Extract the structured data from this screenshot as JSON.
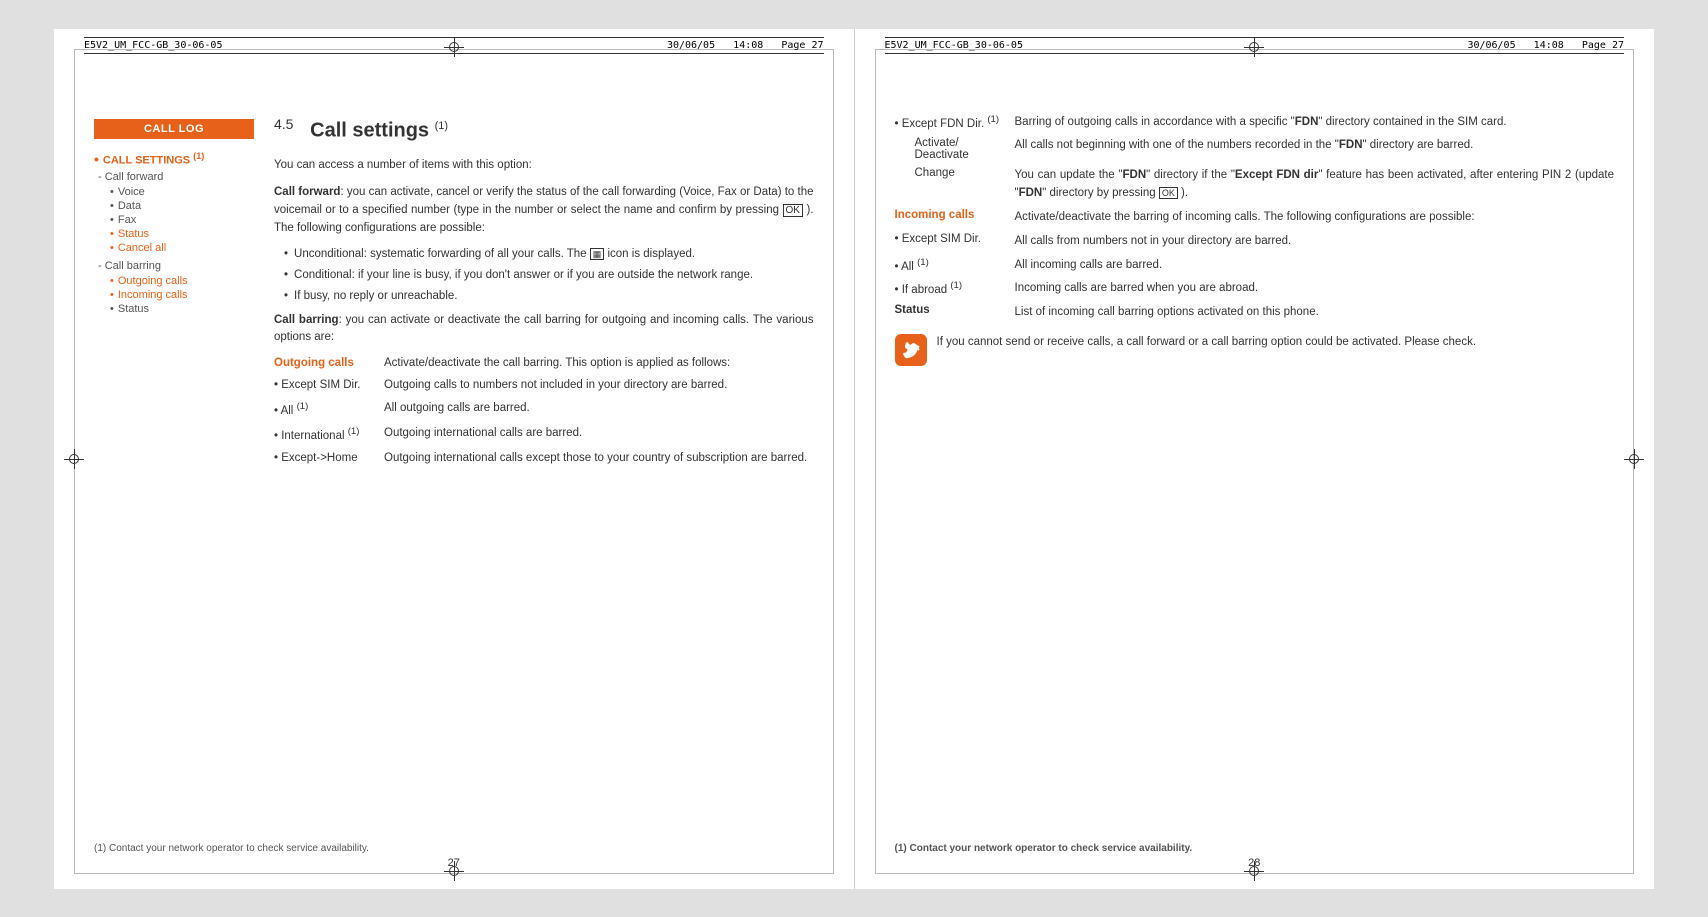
{
  "meta": {
    "doc_id": "E5V2_UM_FCC-GB_30-06-05",
    "date": "30/06/05",
    "time": "14:08",
    "page_ref": "Page 27"
  },
  "sidebar": {
    "header": "CALL LOG",
    "items": [
      {
        "label": "CALL SETTINGS",
        "superscript": "(1)",
        "children": [
          {
            "type": "dash",
            "label": "Call forward",
            "children": [
              {
                "label": "Voice",
                "color": "normal"
              },
              {
                "label": "Data",
                "color": "normal"
              },
              {
                "label": "Fax",
                "color": "normal"
              },
              {
                "label": "Status",
                "color": "orange"
              },
              {
                "label": "Cancel all",
                "color": "orange"
              }
            ]
          },
          {
            "type": "dash",
            "label": "Call barring",
            "children": [
              {
                "label": "Outgoing calls",
                "color": "orange"
              },
              {
                "label": "Incoming calls",
                "color": "orange"
              },
              {
                "label": "Status",
                "color": "normal"
              }
            ]
          }
        ]
      }
    ]
  },
  "left_page": {
    "section": "4.5",
    "title": "Call settings",
    "superscript": "(1)",
    "intro": "You can access a number of items with this option:",
    "call_forward": {
      "label": "Call forward",
      "text": ": you can activate, cancel or verify the status of the call forwarding (Voice, Fax or Data) to the voicemail or to a specified number (type in the number or select the name and confirm by pressing OK ). The following configurations are possible:"
    },
    "bullets": [
      {
        "text": "Unconditional: systematic forwarding of all your calls. The  icon is displayed."
      },
      {
        "text": "Conditional: if your line is busy, if you don't answer or if you are outside the network range."
      },
      {
        "text": "If busy, no reply or unreachable."
      }
    ],
    "call_barring": {
      "label": "Call barring",
      "text": ": you can activate or deactivate the call barring for outgoing and incoming calls. The various options are:"
    },
    "outgoing_calls": {
      "label": "Outgoing calls",
      "desc": "Activate/deactivate the call barring. This option is applied as follows:"
    },
    "outgoing_options": [
      {
        "label": "• Except SIM Dir.",
        "desc": "Outgoing calls to numbers not included in your directory are barred."
      },
      {
        "label": "• All (1)",
        "desc": "All outgoing calls are barred."
      },
      {
        "label": "• International (1)",
        "desc": "Outgoing international calls are barred."
      },
      {
        "label": "• Except->Home",
        "desc": "Outgoing international calls except those to your country of subscription are barred."
      }
    ],
    "page_number": "27",
    "footnote": "(1)   Contact your network operator to check service availability."
  },
  "right_page": {
    "rows": [
      {
        "label": "• Except FDN Dir. (1)",
        "desc": "Barring of outgoing calls in accordance with a specific \"FDN\" directory contained in the SIM card.",
        "bold_label": false
      },
      {
        "label": "Activate/ Deactivate",
        "desc": "All calls not beginning with one of the numbers recorded in the \"FDN\" directory are barred.",
        "bold_label": false,
        "indent": true
      },
      {
        "label": "Change",
        "desc": "You can update the \"FDN\" directory if the \"Except FDN dir\" feature has been activated, after entering PIN 2 (update \"FDN\" directory by pressing OK ).",
        "bold_label": false,
        "indent": true
      },
      {
        "label": "Incoming calls",
        "desc": "Activate/deactivate the barring of incoming calls. The following configurations are possible:",
        "bold_label": true,
        "incoming": true
      },
      {
        "label": "• Except SIM Dir.",
        "desc": "All calls from numbers not in your directory are barred.",
        "bold_label": false
      },
      {
        "label": "• All (1)",
        "desc": "All incoming calls are barred.",
        "bold_label": false
      },
      {
        "label": "• If abroad (1)",
        "desc": "Incoming calls are barred when you are abroad.",
        "bold_label": false
      },
      {
        "label": "Status",
        "desc": "List of incoming call barring options activated on this phone.",
        "bold_label": true,
        "status": true
      }
    ],
    "notice": "If you cannot send or receive calls, a call forward or a call barring option could be activated. Please check.",
    "page_number": "28",
    "footnote": "(1)   Contact your network operator to check service availability."
  }
}
